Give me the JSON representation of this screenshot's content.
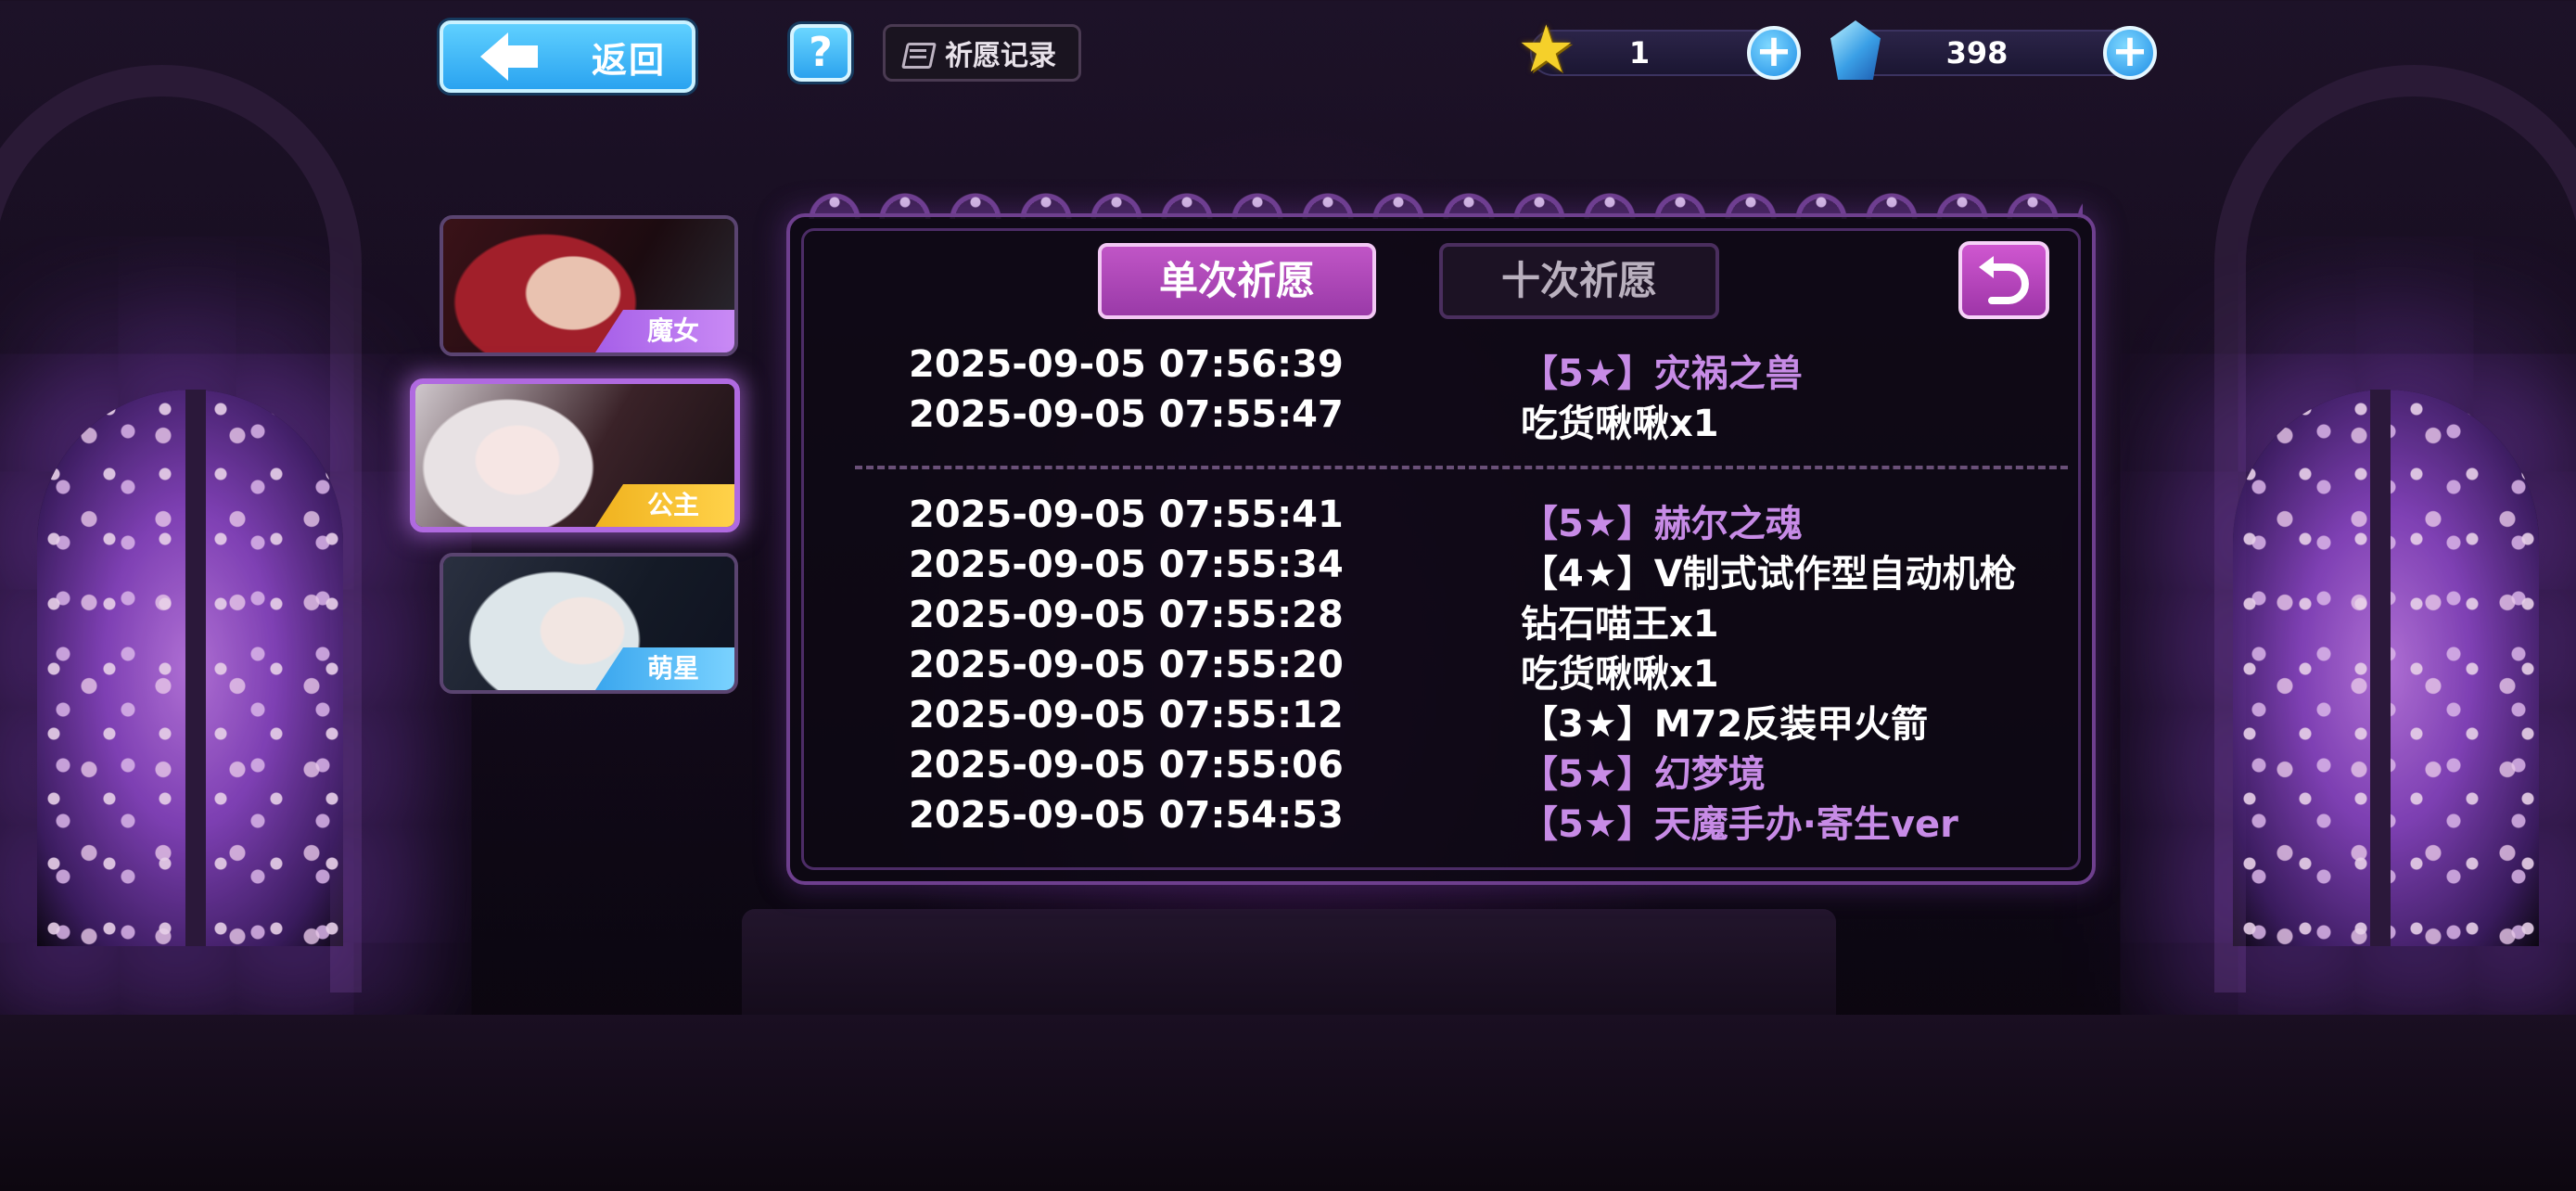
{
  "header": {
    "back_label": "返回",
    "help_label": "?",
    "record_label": "祈愿记录",
    "currencies": [
      {
        "name": "star-currency",
        "value": "1",
        "add_label": "+"
      },
      {
        "name": "crystal-currency",
        "value": "398",
        "add_label": "+"
      }
    ]
  },
  "characters": [
    {
      "tag": "魔女",
      "selected": false
    },
    {
      "tag": "公主",
      "selected": true
    },
    {
      "tag": "萌星",
      "selected": false
    }
  ],
  "tabs": [
    {
      "label": "单次祈愿",
      "active": true
    },
    {
      "label": "十次祈愿",
      "active": false
    }
  ],
  "records_group_1": [
    {
      "time": "2025-09-05 07:56:39",
      "item": "【5★】灾祸之兽",
      "rarity_color": "purple"
    },
    {
      "time": "2025-09-05 07:55:47",
      "item": "吃货啾啾x1",
      "rarity_color": "white"
    }
  ],
  "records_group_2": [
    {
      "time": "2025-09-05 07:55:41",
      "item": "【5★】赫尔之魂",
      "rarity_color": "purple"
    },
    {
      "time": "2025-09-05 07:55:34",
      "item": "【4★】V制式试作型自动机枪",
      "rarity_color": "white"
    },
    {
      "time": "2025-09-05 07:55:28",
      "item": "钻石喵王x1",
      "rarity_color": "white"
    },
    {
      "time": "2025-09-05 07:55:20",
      "item": "吃货啾啾x1",
      "rarity_color": "white"
    },
    {
      "time": "2025-09-05 07:55:12",
      "item": "【3★】M72反装甲火箭",
      "rarity_color": "white"
    },
    {
      "time": "2025-09-05 07:55:06",
      "item": "【5★】幻梦境",
      "rarity_color": "purple"
    },
    {
      "time": "2025-09-05 07:54:53",
      "item": "【5★】天魔手办·寄生ver",
      "rarity_color": "purple"
    }
  ],
  "colors": {
    "accent_blue": "#2aa3f0",
    "tab_active": "#b048b8",
    "rare_item": "#c78be6",
    "panel_border": "#6e3f8e"
  }
}
